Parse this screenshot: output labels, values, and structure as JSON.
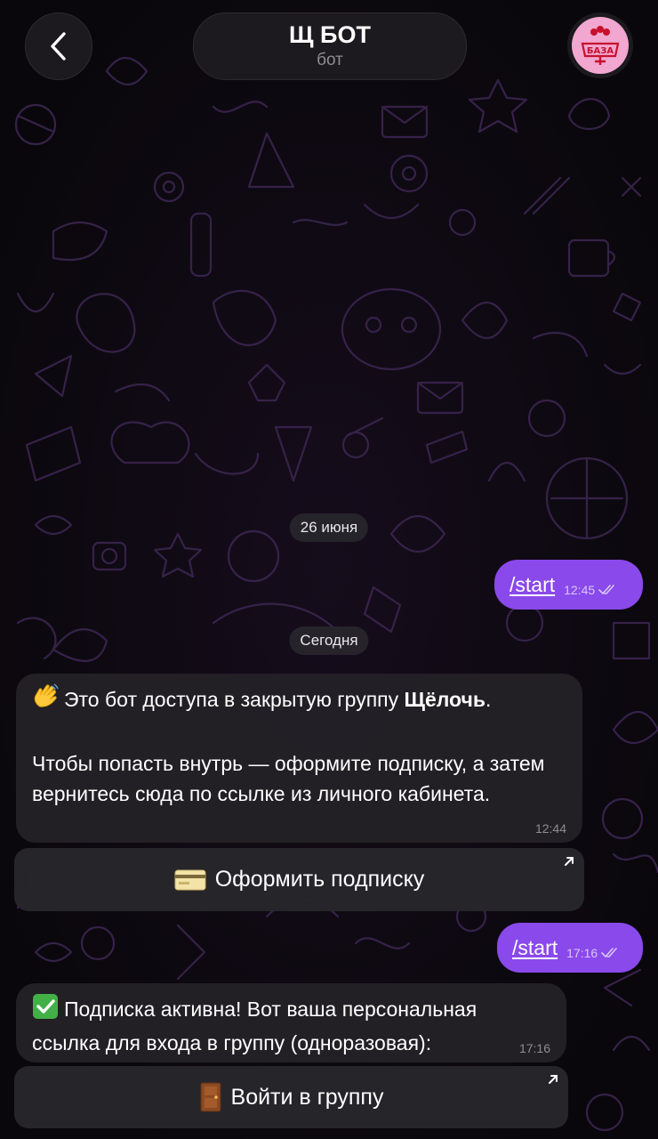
{
  "header": {
    "back_icon": "chevron-left-icon",
    "title": "Щ БОТ",
    "subtitle": "бот",
    "avatar_text": "БАЗА"
  },
  "messages": {
    "date_1": "26 июня",
    "start_1": {
      "text": "/start",
      "time": "12:45"
    },
    "date_2": "Сегодня",
    "welcome": {
      "line1_pre": "Это бот доступа в закрытую группу ",
      "line1_bold": "Щёлочь",
      "line1_post": ".",
      "para2": "Чтобы попасть внутрь — оформите подписку, а затем вернитесь сюда по ссылке из личного кабинета.",
      "time": "12:44"
    },
    "subscribe_button": "Оформить подписку",
    "start_2": {
      "text": "/start",
      "time": "17:16"
    },
    "active": {
      "text": "Подписка активна! Вот ваша персональная ссылка для входа в группу (одноразовая):",
      "time": "17:16"
    },
    "join_button": "Войти в группу"
  },
  "colors": {
    "outgoing_bubble": "#8a49ea",
    "incoming_bubble": "#232127",
    "background": "#0a070c",
    "doodle": "#3a2450"
  }
}
